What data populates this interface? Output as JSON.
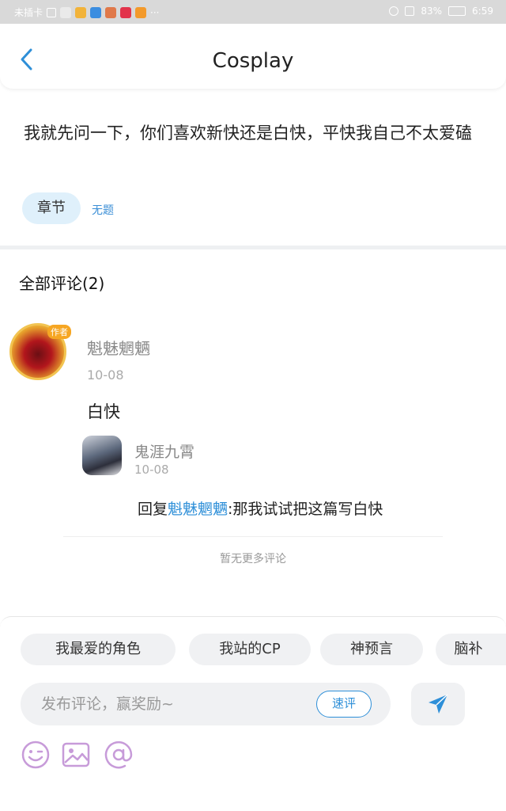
{
  "status_bar": {
    "carrier": "未插卡",
    "battery": "83%",
    "time": "6:59"
  },
  "header": {
    "title": "Cosplay"
  },
  "post": {
    "body": "我就先问一下，你们喜欢新快还是白快，平快我自己不太爱磕",
    "tag": "章节",
    "tag_sub": "无题"
  },
  "comments": {
    "header": "全部评论(2)",
    "items": [
      {
        "badge": "作者",
        "name": "魁魅魍魉",
        "date": "10-08",
        "text": "白快",
        "reply": {
          "name": "鬼涯九霄",
          "date": "10-08",
          "prefix": "回复",
          "mention": "魁魅魍魉",
          "text": ":那我试试把这篇写白快"
        }
      }
    ],
    "no_more": "暂无更多评论"
  },
  "quick_tags": [
    "我最爱的角色",
    "我站的CP",
    "神预言",
    "脑补"
  ],
  "input": {
    "placeholder": "发布评论，赢奖励~",
    "quick_label": "速评"
  },
  "icons": {
    "back": "chevron-left-icon",
    "send": "send-icon",
    "emoji": "emoji-icon",
    "image": "image-icon",
    "mention": "at-icon"
  },
  "colors": {
    "accent": "#2e8fd8",
    "tool_purple": "#c79bd9",
    "tag_bg": "#dff0fb"
  }
}
